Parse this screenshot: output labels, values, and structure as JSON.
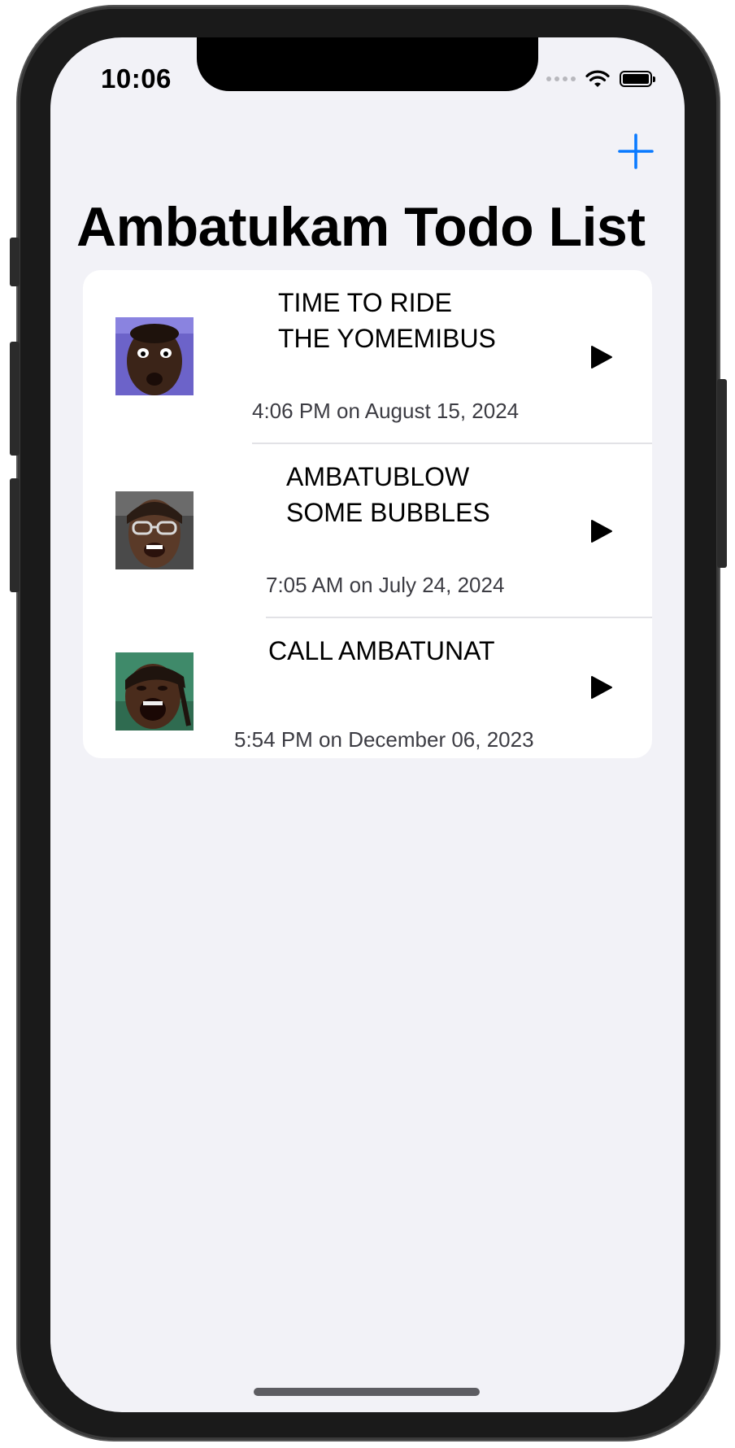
{
  "status_bar": {
    "time": "10:06"
  },
  "header": {
    "title": "Ambatukam Todo List",
    "add_icon": "plus-icon",
    "accent_color": "#0a7aff"
  },
  "todos": [
    {
      "title": "TIME TO RIDE\nTHE YOMEMIBUS",
      "timestamp": "4:06 PM on August 15, 2024",
      "thumbnail": "face-thumbnail",
      "action_icon": "play-icon"
    },
    {
      "title": "AMBATUBLOW\nSOME BUBBLES",
      "timestamp": "7:05 AM on July 24, 2024",
      "thumbnail": "face-thumbnail",
      "action_icon": "play-icon"
    },
    {
      "title": "CALL AMBATUNAT",
      "timestamp": "5:54 PM on December 06, 2023",
      "thumbnail": "face-thumbnail",
      "action_icon": "play-icon"
    }
  ]
}
